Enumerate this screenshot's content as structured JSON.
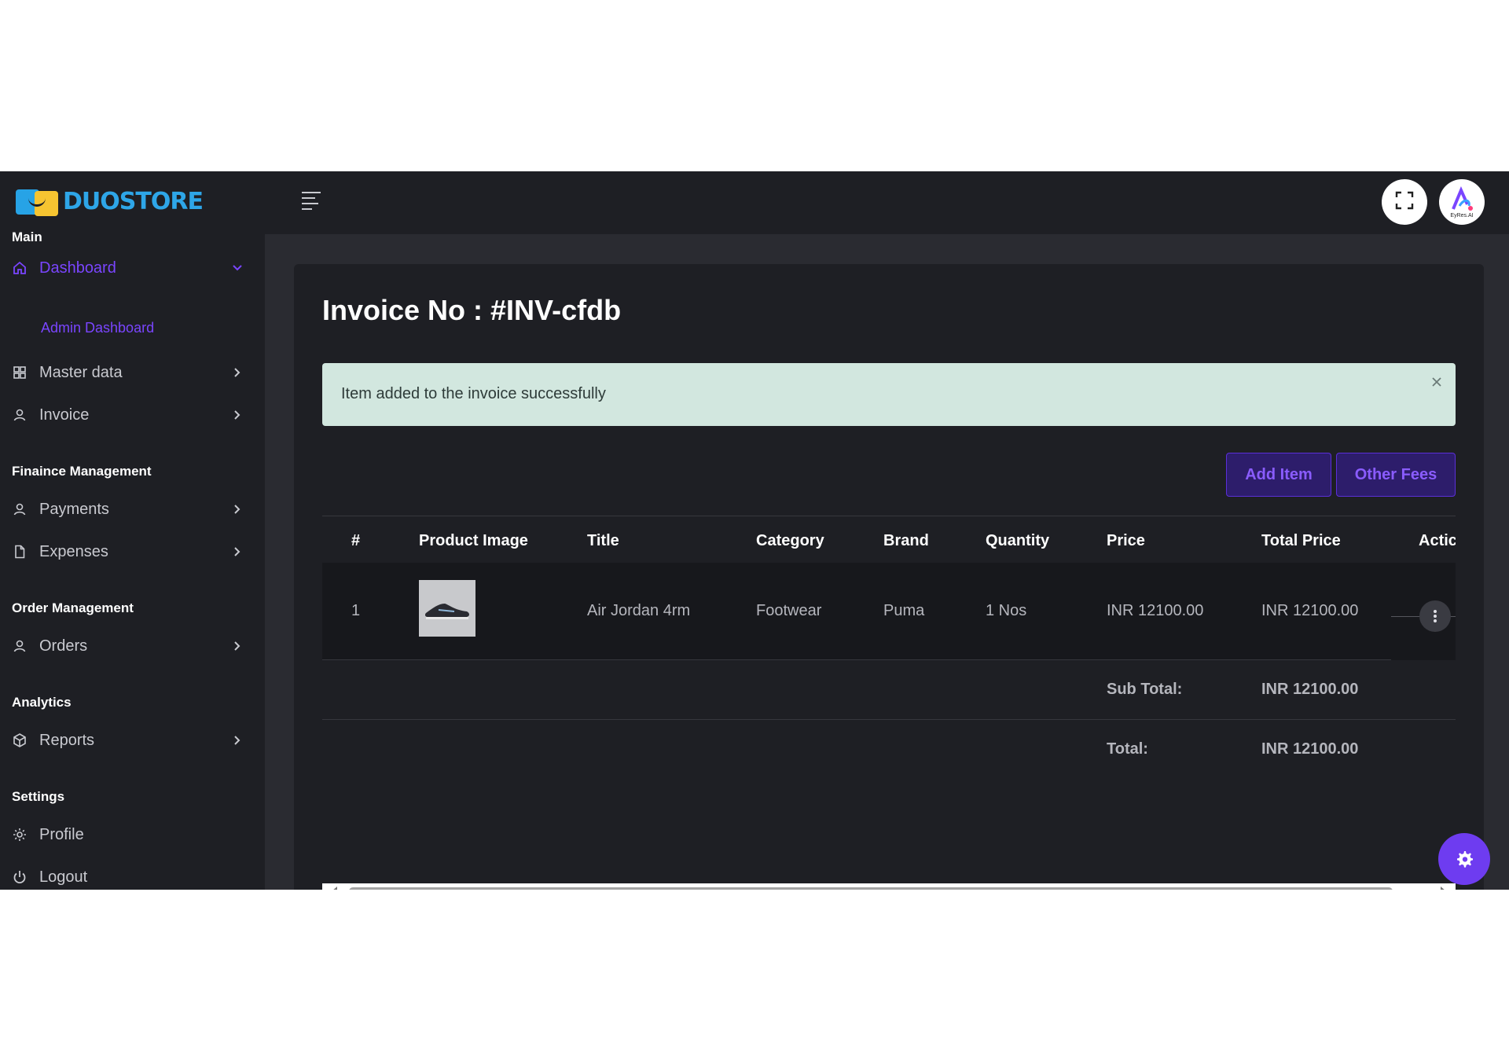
{
  "brand": {
    "name": "DUOSTORE"
  },
  "sidebar": {
    "sections": {
      "main": "Main",
      "finance": "Finaince Management",
      "orders": "Order Management",
      "analytics": "Analytics",
      "settings": "Settings"
    },
    "items": {
      "dashboard": "Dashboard",
      "admin_dashboard": "Admin Dashboard",
      "master_data": "Master data",
      "invoice": "Invoice",
      "payments": "Payments",
      "expenses": "Expenses",
      "orders": "Orders",
      "reports": "Reports",
      "profile": "Profile",
      "logout": "Logout"
    }
  },
  "header": {
    "avatar_text": "EyRes.AI"
  },
  "page": {
    "title": "Invoice No : #INV-cfdb"
  },
  "alert": {
    "message": "Item added to the invoice successfully"
  },
  "actions": {
    "add_item": "Add Item",
    "other_fees": "Other Fees"
  },
  "table": {
    "columns": [
      "#",
      "Product Image",
      "Title",
      "Category",
      "Brand",
      "Quantity",
      "Price",
      "Total Price",
      "Actic"
    ],
    "rows": [
      {
        "index": "1",
        "title": "Air Jordan 4rm",
        "category": "Footwear",
        "brand": "Puma",
        "quantity": "1 Nos",
        "price": "INR 12100.00",
        "total_price": "INR 12100.00"
      }
    ],
    "subtotal_label": "Sub Total:",
    "subtotal_value": "INR 12100.00",
    "total_label": "Total:",
    "total_value": "INR 12100.00"
  },
  "colors": {
    "accent": "#7a45ff",
    "alert_bg": "#d2e7df",
    "sidebar_bg": "#1e1f24",
    "content_bg": "#2a2b31"
  },
  "icons": [
    "home-icon",
    "grid-icon",
    "user-icon",
    "file-icon",
    "box-icon",
    "gear-icon",
    "power-icon",
    "chevron-right-icon",
    "chevron-down-icon",
    "menu-icon",
    "fullscreen-icon",
    "close-icon",
    "kebab-icon"
  ]
}
